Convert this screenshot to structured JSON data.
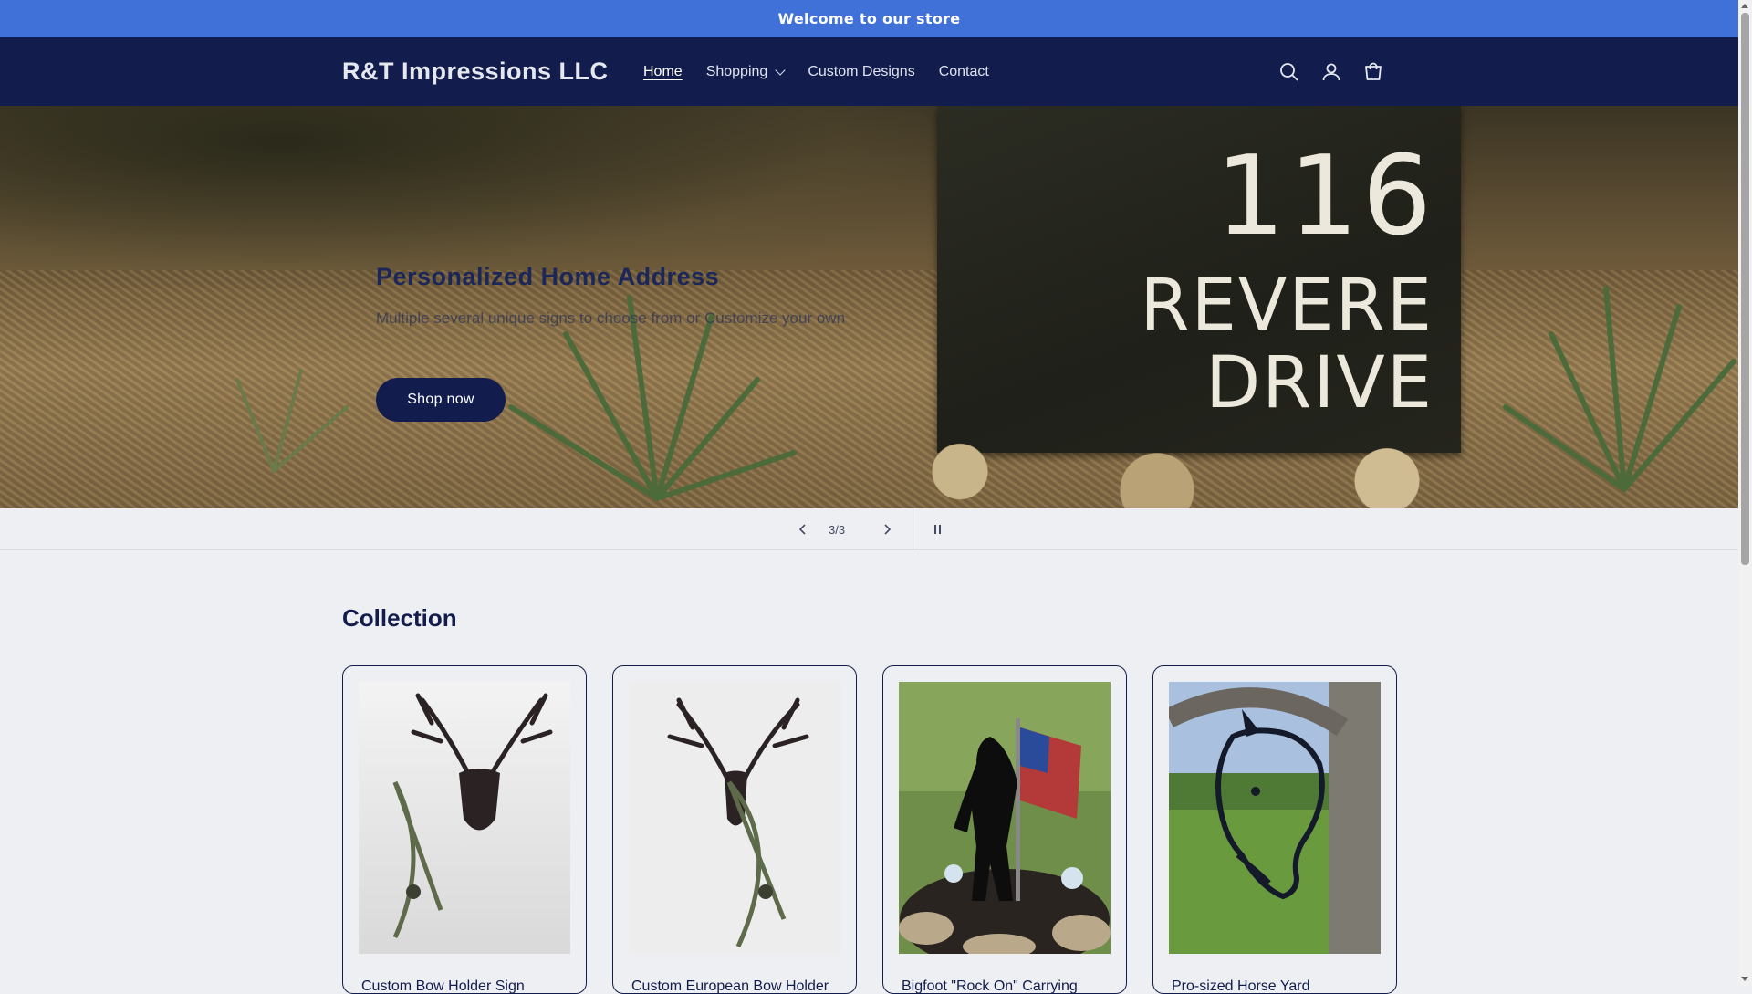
{
  "announcement": "Welcome to our store",
  "header": {
    "logo": "R&T Impressions LLC",
    "nav": [
      {
        "label": "Home",
        "active": true
      },
      {
        "label": "Shopping",
        "dropdown": true
      },
      {
        "label": "Custom Designs"
      },
      {
        "label": "Contact"
      }
    ],
    "icons": [
      "search-icon",
      "account-icon",
      "cart-icon"
    ]
  },
  "hero": {
    "title": "Personalized Home Address",
    "subtitle": "Multiple several unique signs to choose from or Customize your own",
    "button": "Shop now",
    "sign_number": "116",
    "sign_line1": "REVERE",
    "sign_line2": "DRIVE"
  },
  "slider": {
    "counter": "3/3"
  },
  "collection": {
    "title": "Collection",
    "products": [
      {
        "name": "Custom Bow Holder Sign"
      },
      {
        "name": "Custom European Bow Holder"
      },
      {
        "name": "Bigfoot \"Rock On\" Carrying"
      },
      {
        "name": "Pro-sized Horse Yard"
      }
    ]
  },
  "colors": {
    "announcement_bg": "#4071d8",
    "header_bg": "#121d4d",
    "page_bg": "#eeeff3",
    "primary": "#121d4d"
  }
}
